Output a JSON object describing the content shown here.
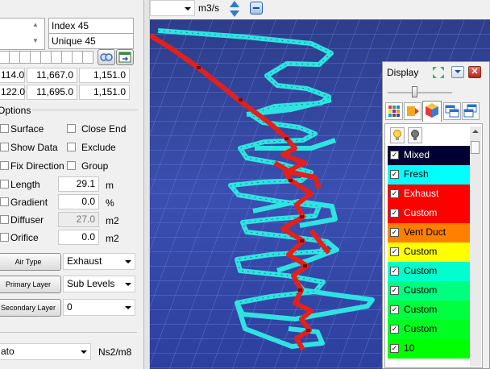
{
  "info_box": {
    "index_label": "Index 45",
    "unique_label": "Unique 45"
  },
  "coords": {
    "row1": [
      "114.0",
      "11,667.0",
      "1,151.0"
    ],
    "row2": [
      "122.0",
      "11,695.0",
      "1,151.0"
    ]
  },
  "options": {
    "title": "Options",
    "checks_left": [
      "Surface",
      "Show Data",
      "Fix Direction"
    ],
    "checks_right": [
      "Close End",
      "Exclude",
      "Group"
    ],
    "length": {
      "label": "Length",
      "value": "29.1",
      "unit": "m"
    },
    "gradient": {
      "label": "Gradient",
      "value": "0.0",
      "unit": "%"
    },
    "diffuser": {
      "label": "Diffuser",
      "value": "27.0",
      "unit": "m2"
    },
    "orifice": {
      "label": "Orifice",
      "value": "0.0",
      "unit": "m2"
    }
  },
  "layers": {
    "air_type": {
      "button": "Air Type",
      "value": "Exhaust"
    },
    "primary": {
      "button": "Primary Layer",
      "value": "Sub Levels"
    },
    "secondary": {
      "button": "Secondary Layer",
      "value": "0"
    }
  },
  "resistance": {
    "value": "ato",
    "unit": "Ns2/m8"
  },
  "toolbar": {
    "unit": "m3/s"
  },
  "display": {
    "title": "Display",
    "items": [
      {
        "label": "Mixed",
        "color": "#000033",
        "text_color": "#ffffff"
      },
      {
        "label": "Fresh",
        "color": "#00ffff",
        "text_color": "#000000"
      },
      {
        "label": "Exhaust",
        "color": "#ff0000",
        "text_color": "#ffffff"
      },
      {
        "label": "Custom",
        "color": "#ff0000",
        "text_color": "#ffffff"
      },
      {
        "label": "Vent Duct",
        "color": "#ff8000",
        "text_color": "#000000"
      },
      {
        "label": "Custom",
        "color": "#ffff00",
        "text_color": "#000000"
      },
      {
        "label": "Custom",
        "color": "#00ffcc",
        "text_color": "#000000"
      },
      {
        "label": "Custom",
        "color": "#00ff80",
        "text_color": "#000000"
      },
      {
        "label": "Custom",
        "color": "#00ff40",
        "text_color": "#000000"
      },
      {
        "label": "Custom",
        "color": "#00ff20",
        "text_color": "#000000"
      },
      {
        "label": "10",
        "color": "#00ff00",
        "text_color": "#000000"
      }
    ]
  }
}
